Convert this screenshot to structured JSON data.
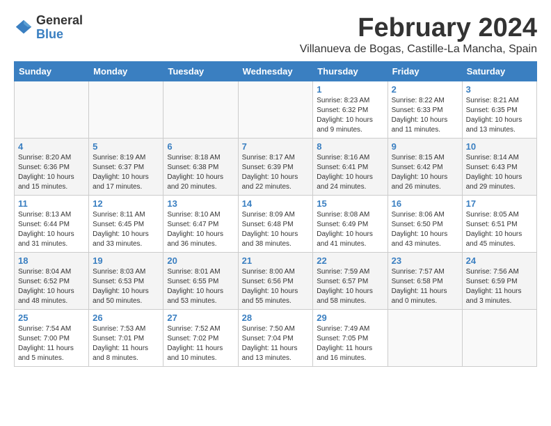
{
  "logo": {
    "general": "General",
    "blue": "Blue"
  },
  "title": "February 2024",
  "subtitle": "Villanueva de Bogas, Castille-La Mancha, Spain",
  "days_of_week": [
    "Sunday",
    "Monday",
    "Tuesday",
    "Wednesday",
    "Thursday",
    "Friday",
    "Saturday"
  ],
  "weeks": [
    [
      {
        "day": "",
        "info": ""
      },
      {
        "day": "",
        "info": ""
      },
      {
        "day": "",
        "info": ""
      },
      {
        "day": "",
        "info": ""
      },
      {
        "day": "1",
        "info": "Sunrise: 8:23 AM\nSunset: 6:32 PM\nDaylight: 10 hours and 9 minutes."
      },
      {
        "day": "2",
        "info": "Sunrise: 8:22 AM\nSunset: 6:33 PM\nDaylight: 10 hours and 11 minutes."
      },
      {
        "day": "3",
        "info": "Sunrise: 8:21 AM\nSunset: 6:35 PM\nDaylight: 10 hours and 13 minutes."
      }
    ],
    [
      {
        "day": "4",
        "info": "Sunrise: 8:20 AM\nSunset: 6:36 PM\nDaylight: 10 hours and 15 minutes."
      },
      {
        "day": "5",
        "info": "Sunrise: 8:19 AM\nSunset: 6:37 PM\nDaylight: 10 hours and 17 minutes."
      },
      {
        "day": "6",
        "info": "Sunrise: 8:18 AM\nSunset: 6:38 PM\nDaylight: 10 hours and 20 minutes."
      },
      {
        "day": "7",
        "info": "Sunrise: 8:17 AM\nSunset: 6:39 PM\nDaylight: 10 hours and 22 minutes."
      },
      {
        "day": "8",
        "info": "Sunrise: 8:16 AM\nSunset: 6:41 PM\nDaylight: 10 hours and 24 minutes."
      },
      {
        "day": "9",
        "info": "Sunrise: 8:15 AM\nSunset: 6:42 PM\nDaylight: 10 hours and 26 minutes."
      },
      {
        "day": "10",
        "info": "Sunrise: 8:14 AM\nSunset: 6:43 PM\nDaylight: 10 hours and 29 minutes."
      }
    ],
    [
      {
        "day": "11",
        "info": "Sunrise: 8:13 AM\nSunset: 6:44 PM\nDaylight: 10 hours and 31 minutes."
      },
      {
        "day": "12",
        "info": "Sunrise: 8:11 AM\nSunset: 6:45 PM\nDaylight: 10 hours and 33 minutes."
      },
      {
        "day": "13",
        "info": "Sunrise: 8:10 AM\nSunset: 6:47 PM\nDaylight: 10 hours and 36 minutes."
      },
      {
        "day": "14",
        "info": "Sunrise: 8:09 AM\nSunset: 6:48 PM\nDaylight: 10 hours and 38 minutes."
      },
      {
        "day": "15",
        "info": "Sunrise: 8:08 AM\nSunset: 6:49 PM\nDaylight: 10 hours and 41 minutes."
      },
      {
        "day": "16",
        "info": "Sunrise: 8:06 AM\nSunset: 6:50 PM\nDaylight: 10 hours and 43 minutes."
      },
      {
        "day": "17",
        "info": "Sunrise: 8:05 AM\nSunset: 6:51 PM\nDaylight: 10 hours and 45 minutes."
      }
    ],
    [
      {
        "day": "18",
        "info": "Sunrise: 8:04 AM\nSunset: 6:52 PM\nDaylight: 10 hours and 48 minutes."
      },
      {
        "day": "19",
        "info": "Sunrise: 8:03 AM\nSunset: 6:53 PM\nDaylight: 10 hours and 50 minutes."
      },
      {
        "day": "20",
        "info": "Sunrise: 8:01 AM\nSunset: 6:55 PM\nDaylight: 10 hours and 53 minutes."
      },
      {
        "day": "21",
        "info": "Sunrise: 8:00 AM\nSunset: 6:56 PM\nDaylight: 10 hours and 55 minutes."
      },
      {
        "day": "22",
        "info": "Sunrise: 7:59 AM\nSunset: 6:57 PM\nDaylight: 10 hours and 58 minutes."
      },
      {
        "day": "23",
        "info": "Sunrise: 7:57 AM\nSunset: 6:58 PM\nDaylight: 11 hours and 0 minutes."
      },
      {
        "day": "24",
        "info": "Sunrise: 7:56 AM\nSunset: 6:59 PM\nDaylight: 11 hours and 3 minutes."
      }
    ],
    [
      {
        "day": "25",
        "info": "Sunrise: 7:54 AM\nSunset: 7:00 PM\nDaylight: 11 hours and 5 minutes."
      },
      {
        "day": "26",
        "info": "Sunrise: 7:53 AM\nSunset: 7:01 PM\nDaylight: 11 hours and 8 minutes."
      },
      {
        "day": "27",
        "info": "Sunrise: 7:52 AM\nSunset: 7:02 PM\nDaylight: 11 hours and 10 minutes."
      },
      {
        "day": "28",
        "info": "Sunrise: 7:50 AM\nSunset: 7:04 PM\nDaylight: 11 hours and 13 minutes."
      },
      {
        "day": "29",
        "info": "Sunrise: 7:49 AM\nSunset: 7:05 PM\nDaylight: 11 hours and 16 minutes."
      },
      {
        "day": "",
        "info": ""
      },
      {
        "day": "",
        "info": ""
      }
    ]
  ]
}
